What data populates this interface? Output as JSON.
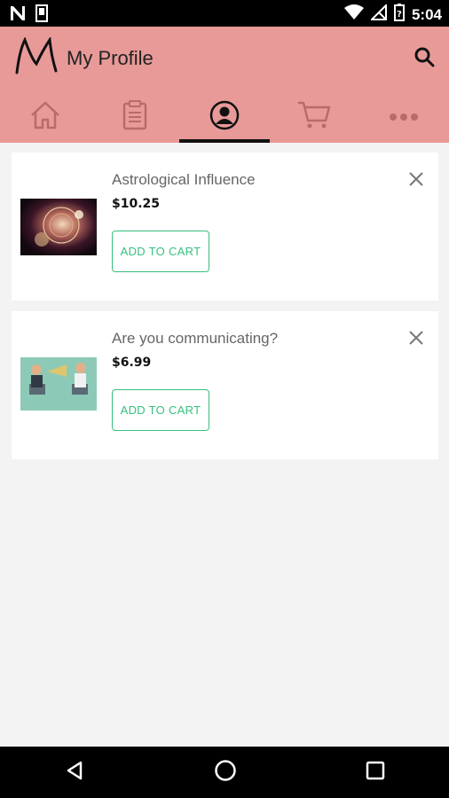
{
  "status_bar": {
    "time": "5:04",
    "icons": [
      "n-notification-icon",
      "sd-card-icon",
      "wifi-icon",
      "no-signal-icon",
      "battery-icon"
    ]
  },
  "app_bar": {
    "logo_letter": "M",
    "title": "My Profile",
    "background_color": "#e89a98"
  },
  "tabs": [
    {
      "icon": "home-icon",
      "active": false
    },
    {
      "icon": "clipboard-icon",
      "active": false
    },
    {
      "icon": "profile-icon",
      "active": true
    },
    {
      "icon": "cart-icon",
      "active": false
    },
    {
      "icon": "more-icon",
      "active": false
    }
  ],
  "items": [
    {
      "title": "Astrological Influence",
      "price": "$10.25",
      "button_label": "ADD TO CART"
    },
    {
      "title": "Are you communicating?",
      "price": "$6.99",
      "button_label": "ADD TO CART"
    }
  ],
  "colors": {
    "accent": "#36c07e",
    "background": "#f3f3f3"
  },
  "nav_bar": {
    "buttons": [
      "back-icon",
      "home-circle-icon",
      "recents-icon"
    ]
  }
}
